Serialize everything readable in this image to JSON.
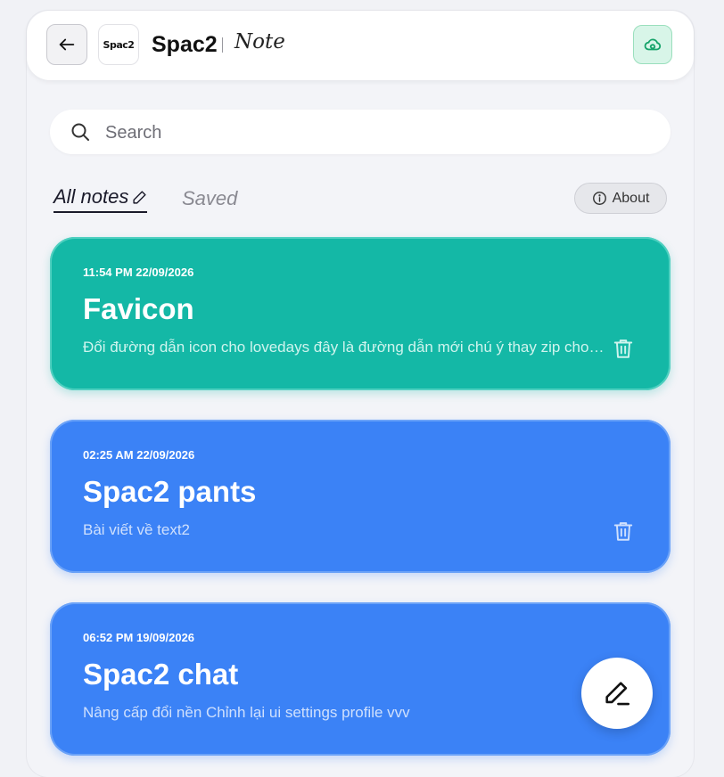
{
  "header": {
    "logo_text": "Spac2",
    "app_name": "Spac2",
    "section": "Note"
  },
  "search": {
    "placeholder": "Search"
  },
  "tabs": [
    {
      "label": "All notes",
      "active": true
    },
    {
      "label": "Saved",
      "active": false
    }
  ],
  "about_label": "About",
  "notes": [
    {
      "time": "11:54 PM 22/09/2026",
      "title": "Favicon",
      "body": "Đổi đường dẫn icon cho lovedays đây là đường dẫn mới chú ý thay zip cho đúng",
      "color": "#14b8a6"
    },
    {
      "time": "02:25 AM 22/09/2026",
      "title": "Spac2 pants",
      "body": "Bài viết về text2",
      "color": "#3b82f6"
    },
    {
      "time": "06:52 PM 19/09/2026",
      "title": "Spac2 chat",
      "body": "Nâng cấp đổi nền Chỉnh lại ui settings profile vvv",
      "color": "#3b82f6"
    }
  ],
  "icons": {
    "back": "arrow-left-icon",
    "cloud": "cloud-sync-icon",
    "search": "search-icon",
    "edit": "pencil-icon",
    "info": "info-icon",
    "trash": "trash-icon",
    "compose": "compose-pencil-icon"
  }
}
